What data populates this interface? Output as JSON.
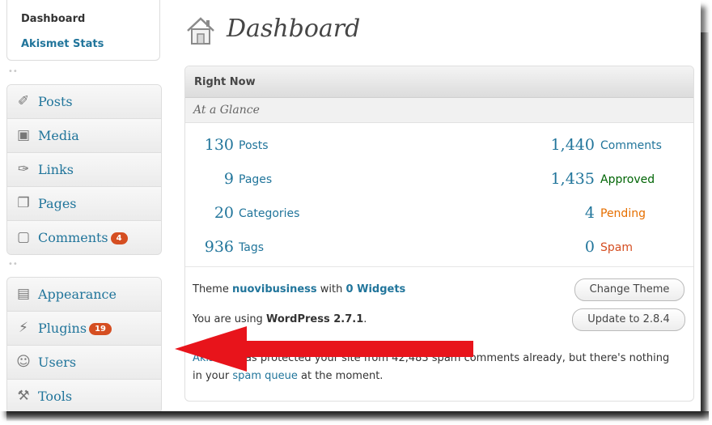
{
  "sidebar": {
    "submenu": {
      "current": "Dashboard",
      "other": "Akismet Stats"
    },
    "group1": [
      {
        "label": "Posts",
        "icon": "pushpin-icon"
      },
      {
        "label": "Media",
        "icon": "media-icon"
      },
      {
        "label": "Links",
        "icon": "link-icon"
      },
      {
        "label": "Pages",
        "icon": "pages-icon"
      },
      {
        "label": "Comments",
        "icon": "comment-icon",
        "badge": "4"
      }
    ],
    "group2": [
      {
        "label": "Appearance",
        "icon": "appearance-icon"
      },
      {
        "label": "Plugins",
        "icon": "plugin-icon",
        "badge": "19"
      },
      {
        "label": "Users",
        "icon": "users-icon"
      },
      {
        "label": "Tools",
        "icon": "tools-icon"
      }
    ]
  },
  "page": {
    "title": "Dashboard",
    "icon": "home-icon"
  },
  "right_now": {
    "title": "Right Now",
    "subtitle": "At a Glance",
    "left": [
      {
        "count": "130",
        "label": "Posts"
      },
      {
        "count": "9",
        "label": "Pages"
      },
      {
        "count": "20",
        "label": "Categories"
      },
      {
        "count": "936",
        "label": "Tags"
      }
    ],
    "right": [
      {
        "count": "1,440",
        "label": "Comments"
      },
      {
        "count": "1,435",
        "label": "Approved"
      },
      {
        "count": "4",
        "label": "Pending"
      },
      {
        "count": "0",
        "label": "Spam"
      }
    ],
    "theme_prefix": "Theme ",
    "theme_name": "nuovibusiness",
    "theme_with": " with ",
    "theme_widgets": "0 Widgets",
    "version_prefix": "You are using ",
    "version": "WordPress 2.7.1",
    "version_suffix": ".",
    "change_theme_button": "Change Theme",
    "update_button": "Update to 2.8.4",
    "akismet_link": "Akismet",
    "akismet_text1": " has protected your site from 42,483 spam comments already, but there's nothing in your ",
    "akismet_queue_link": "spam queue",
    "akismet_text2": " at the moment."
  },
  "colors": {
    "link": "#21759b",
    "approved": "#006505",
    "pending": "#e66f00",
    "spam": "#d54e21",
    "badge": "#d54e21",
    "arrow": "#e8141b"
  }
}
